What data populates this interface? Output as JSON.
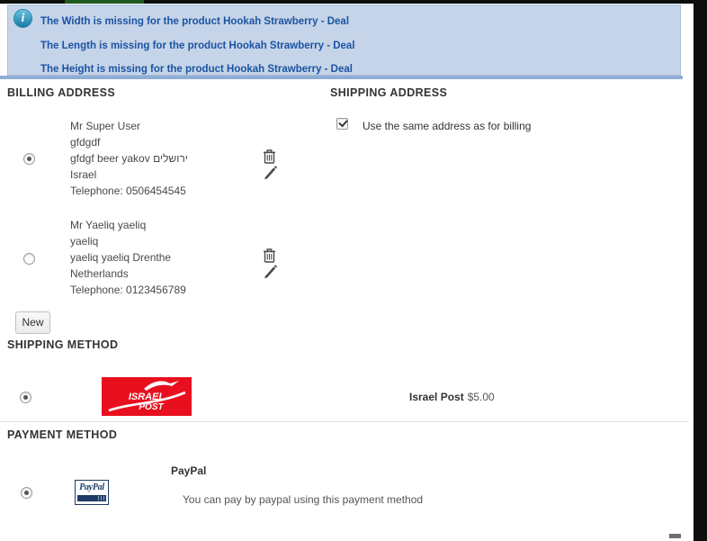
{
  "notifications": {
    "icon_glyph": "i",
    "items": [
      "The Width is missing for the product Hookah Strawberry - Deal",
      "The Length is missing for the product Hookah Strawberry - Deal",
      "The Height is missing for the product Hookah Strawberry - Deal"
    ]
  },
  "billing": {
    "title": "BILLING ADDRESS",
    "new_button_label": "New",
    "addresses": [
      {
        "selected": true,
        "lines": [
          "Mr Super User",
          "gfdgdf",
          "gfdgf beer yakov ירושלים",
          "Israel",
          "Telephone: 0506454545"
        ]
      },
      {
        "selected": false,
        "lines": [
          "Mr Yaeliq yaeliq",
          "yaeliq",
          "yaeliq yaeliq Drenthe",
          "Netherlands",
          "Telephone: 0123456789"
        ]
      }
    ]
  },
  "shipping_address": {
    "title": "SHIPPING ADDRESS",
    "checkbox_checked": true,
    "checkbox_label": "Use the same address as for billing"
  },
  "shipping_method": {
    "title": "SHIPPING METHOD",
    "option": {
      "selected": true,
      "logo_line1": "ISRAEL",
      "logo_line2": "POST",
      "name": "Israel Post",
      "price": "$5.00"
    }
  },
  "payment_method": {
    "title": "PAYMENT METHOD",
    "option": {
      "selected": true,
      "logo_text": "PayPal",
      "name": "PayPal",
      "description": "You can pay by paypal using this payment method"
    }
  },
  "colors": {
    "banner_bg": "#c5d4e8",
    "banner_border": "#8fadd3",
    "banner_text": "#1b53a3",
    "info_icon": "#1578a6",
    "israel_post_red": "#e8101f",
    "paypal_navy": "#1d3b63",
    "top_bar_green": "#1e5a1e"
  }
}
